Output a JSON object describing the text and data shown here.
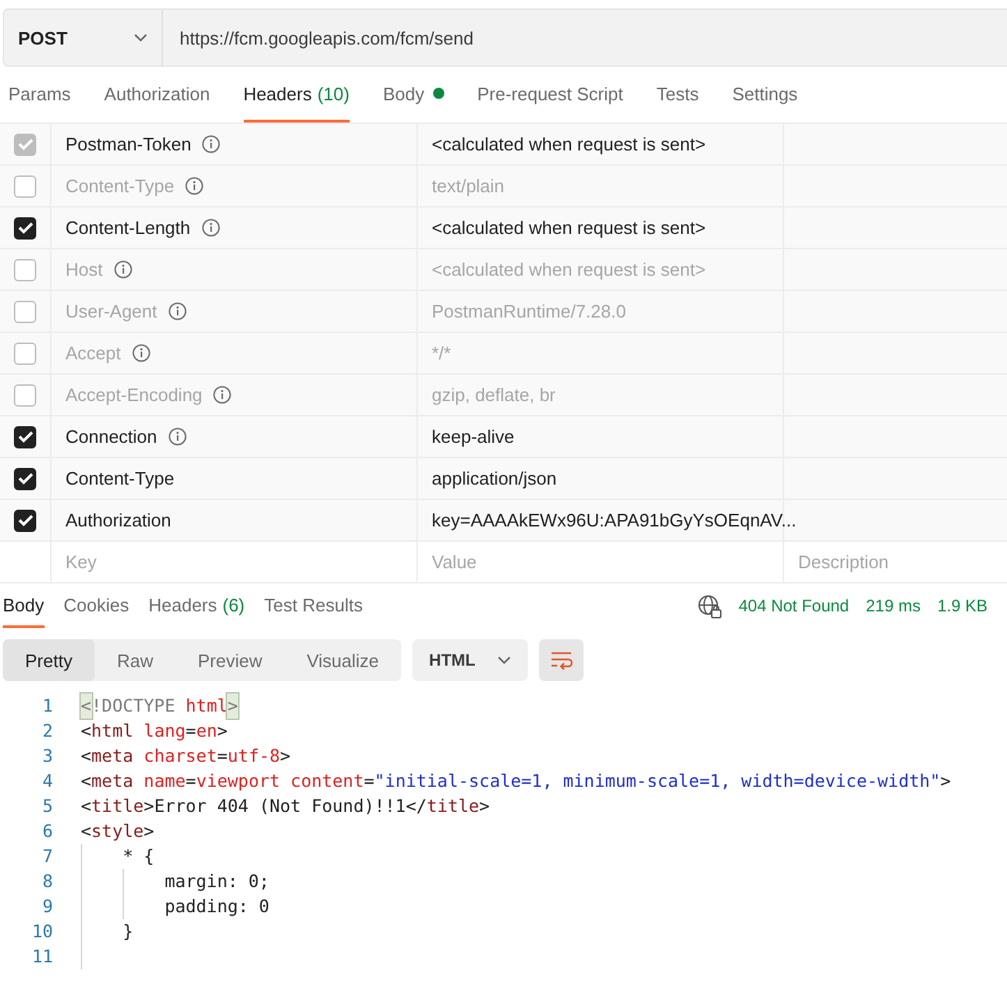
{
  "request": {
    "method": "POST",
    "url": "https://fcm.googleapis.com/fcm/send"
  },
  "request_tabs": [
    {
      "label": "Params",
      "selected": false,
      "dot": false
    },
    {
      "label": "Authorization",
      "selected": false,
      "dot": false
    },
    {
      "label": "Headers",
      "count": "(10)",
      "selected": true,
      "dot": false
    },
    {
      "label": "Body",
      "selected": false,
      "dot": true
    },
    {
      "label": "Pre-request Script",
      "selected": false,
      "dot": false
    },
    {
      "label": "Tests",
      "selected": false,
      "dot": false
    },
    {
      "label": "Settings",
      "selected": false,
      "dot": false
    }
  ],
  "headers": [
    {
      "key": "Postman-Token",
      "info": true,
      "value": "<calculated when request is sent>",
      "checked": true,
      "locked": true
    },
    {
      "key": "Content-Type",
      "info": true,
      "value": "text/plain",
      "checked": false,
      "locked": false
    },
    {
      "key": "Content-Length",
      "info": true,
      "value": "<calculated when request is sent>",
      "checked": true,
      "locked": false
    },
    {
      "key": "Host",
      "info": true,
      "value": "<calculated when request is sent>",
      "checked": false,
      "locked": false
    },
    {
      "key": "User-Agent",
      "info": true,
      "value": "PostmanRuntime/7.28.0",
      "checked": false,
      "locked": false
    },
    {
      "key": "Accept",
      "info": true,
      "value": "*/*",
      "checked": false,
      "locked": false
    },
    {
      "key": "Accept-Encoding",
      "info": true,
      "value": "gzip, deflate, br",
      "checked": false,
      "locked": false
    },
    {
      "key": "Connection",
      "info": true,
      "value": "keep-alive",
      "checked": true,
      "locked": false
    },
    {
      "key": "Content-Type",
      "info": false,
      "value": "application/json",
      "checked": true,
      "locked": false
    },
    {
      "key": "Authorization",
      "info": false,
      "value": "key=AAAAkEWx96U:APA91bGyYsOEqnAV...",
      "checked": true,
      "locked": false
    }
  ],
  "new_header": {
    "key": {
      "placeholder": "Key"
    },
    "value": {
      "placeholder": "Value"
    },
    "description": {
      "placeholder": "Description"
    }
  },
  "response": {
    "tabs": [
      {
        "label": "Body",
        "selected": true
      },
      {
        "label": "Cookies",
        "selected": false
      },
      {
        "label": "Headers",
        "count": "(6)",
        "selected": false
      },
      {
        "label": "Test Results",
        "selected": false
      }
    ],
    "status": "404 Not Found",
    "time": "219 ms",
    "size": "1.9 KB",
    "views": [
      {
        "label": "Pretty",
        "selected": true
      },
      {
        "label": "Raw",
        "selected": false
      },
      {
        "label": "Preview",
        "selected": false
      },
      {
        "label": "Visualize",
        "selected": false
      }
    ],
    "format": "HTML",
    "code": [
      {
        "number": "1",
        "segments": [
          {
            "text": "<",
            "kind": "match"
          },
          {
            "text": "!DOCTYPE ",
            "kind": "doctype"
          },
          {
            "text": "html",
            "kind": "attr"
          },
          {
            "text": ">",
            "kind": "match"
          }
        ]
      },
      {
        "number": "2",
        "segments": [
          {
            "text": "<",
            "kind": "punct"
          },
          {
            "text": "html",
            "kind": "tag"
          },
          {
            "text": " lang",
            "kind": "attr"
          },
          {
            "text": "=",
            "kind": "punct"
          },
          {
            "text": "en",
            "kind": "attr"
          },
          {
            "text": ">",
            "kind": "punct"
          }
        ]
      },
      {
        "number": "3",
        "segments": [
          {
            "text": "<",
            "kind": "punct"
          },
          {
            "text": "meta",
            "kind": "tag"
          },
          {
            "text": " charset",
            "kind": "attr"
          },
          {
            "text": "=",
            "kind": "punct"
          },
          {
            "text": "utf-8",
            "kind": "attr"
          },
          {
            "text": ">",
            "kind": "punct"
          }
        ]
      },
      {
        "number": "4",
        "segments": [
          {
            "text": "<",
            "kind": "punct"
          },
          {
            "text": "meta",
            "kind": "tag"
          },
          {
            "text": " name",
            "kind": "attr"
          },
          {
            "text": "=",
            "kind": "punct"
          },
          {
            "text": "viewport",
            "kind": "attr"
          },
          {
            "text": " content",
            "kind": "attr"
          },
          {
            "text": "=",
            "kind": "punct"
          },
          {
            "text": "\"initial-scale=1, minimum-scale=1, width=device-width\"",
            "kind": "string"
          },
          {
            "text": ">",
            "kind": "punct"
          }
        ]
      },
      {
        "number": "5",
        "segments": [
          {
            "text": "<",
            "kind": "punct"
          },
          {
            "text": "title",
            "kind": "tag"
          },
          {
            "text": ">",
            "kind": "punct"
          },
          {
            "text": "Error 404 (Not Found)!!1",
            "kind": "text"
          },
          {
            "text": "</",
            "kind": "punct"
          },
          {
            "text": "title",
            "kind": "tag"
          },
          {
            "text": ">",
            "kind": "punct"
          }
        ]
      },
      {
        "number": "6",
        "segments": [
          {
            "text": "<",
            "kind": "punct"
          },
          {
            "text": "style",
            "kind": "tag"
          },
          {
            "text": ">",
            "kind": "punct"
          }
        ]
      },
      {
        "number": "7",
        "segments": [
          {
            "text": "    * {",
            "kind": "text"
          }
        ]
      },
      {
        "number": "8",
        "segments": [
          {
            "text": "        margin: 0;",
            "kind": "text"
          }
        ]
      },
      {
        "number": "9",
        "segments": [
          {
            "text": "        padding: 0",
            "kind": "text"
          }
        ]
      },
      {
        "number": "10",
        "segments": [
          {
            "text": "    }",
            "kind": "text"
          }
        ]
      },
      {
        "number": "11"
      }
    ]
  }
}
